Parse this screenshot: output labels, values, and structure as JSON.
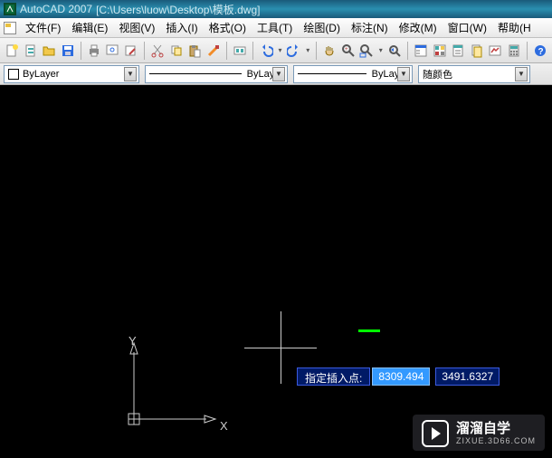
{
  "title": {
    "app": "AutoCAD 2007",
    "path": "[C:\\Users\\luow\\Desktop\\模板.dwg]"
  },
  "menu": {
    "file": "文件(F)",
    "edit": "编辑(E)",
    "view": "视图(V)",
    "insert": "插入(I)",
    "format": "格式(O)",
    "tools": "工具(T)",
    "draw": "绘图(D)",
    "annotate": "标注(N)",
    "modify": "修改(M)",
    "window": "窗口(W)",
    "help": "帮助(H"
  },
  "props": {
    "layer_combo": "ByLayer",
    "linetype_combo": "ByLayer",
    "lineweight_combo": "ByLayer",
    "color_combo": "随颜色",
    "swatch_color": "#ffffff"
  },
  "ucs": {
    "x_label": "X",
    "y_label": "Y"
  },
  "dynamic_input": {
    "prompt": "指定插入点:",
    "x": "8309.494",
    "y": "3491.6327"
  },
  "watermark": {
    "line1": "溜溜自学",
    "line2": "ZIXUE.3D66.COM"
  },
  "icons": {
    "new_c": "#ffffff",
    "open_c": "#f2c94c",
    "save_c": "#2d6cdf",
    "print_c": "#888888",
    "cut_c": "#888888",
    "copy_c": "#f2c94c",
    "paste_c": "#f2c94c",
    "match_c": "#f28c28",
    "undo_c": "#2d6cdf",
    "redo_c": "#2d6cdf",
    "pan_c": "#c0a060",
    "zoom_c": "#555555",
    "props_c": "#808080",
    "help_c": "#2d6cdf"
  }
}
